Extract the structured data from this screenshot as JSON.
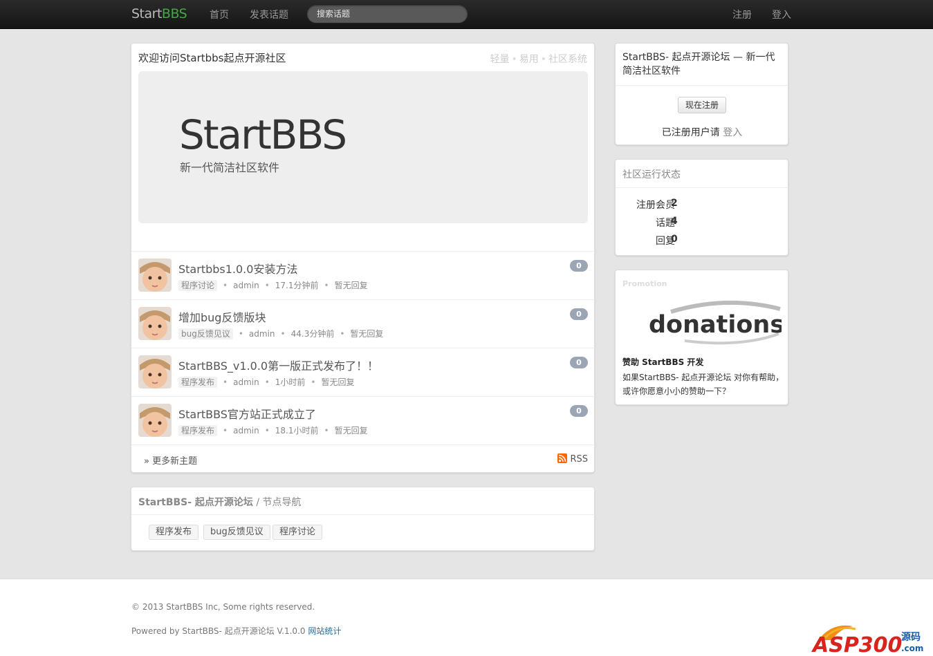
{
  "navbar": {
    "brand_part1": "Start",
    "brand_part2": "BBS",
    "links": [
      "首页",
      "发表话题"
    ],
    "search_placeholder": "搜索话题",
    "register": "注册",
    "login": "登入"
  },
  "welcome": {
    "title": "欢迎访问Startbbs起点开源社区",
    "tagline": [
      "轻量",
      "易用",
      "社区系统"
    ],
    "hero_brand": "StartBBS",
    "hero_sub": "新一代简洁社区软件"
  },
  "topics": [
    {
      "title": "Startbbs1.0.0安装方法",
      "node": "程序讨论",
      "author": "admin",
      "time": "17.1分钟前",
      "reply": "暂无回复",
      "count": "0"
    },
    {
      "title": "增加bug反馈版块",
      "node": "bug反馈见议",
      "author": "admin",
      "time": "44.3分钟前",
      "reply": "暂无回复",
      "count": "0"
    },
    {
      "title": "StartBBS_v1.0.0第一版正式发布了！！",
      "node": "程序发布",
      "author": "admin",
      "time": "1小时前",
      "reply": "暂无回复",
      "count": "0"
    },
    {
      "title": "StartBBS官方站正式成立了",
      "node": "程序发布",
      "author": "admin",
      "time": "18.1小时前",
      "reply": "暂无回复",
      "count": "0"
    }
  ],
  "more": {
    "label": "» 更多新主题",
    "rss": "RSS"
  },
  "nodes_box": {
    "site": "StartBBS- 起点开源论坛",
    "sep": " / 节点导航",
    "nodes": [
      "程序发布",
      "bug反馈见议",
      "程序讨论"
    ]
  },
  "sidebar": {
    "intro": "StartBBS- 起点开源论坛 — 新一代简洁社区软件",
    "register_button": "现在注册",
    "login_hint": "已注册用户请",
    "login_link": "登入",
    "stats_title": "社区运行状态",
    "stats": [
      {
        "label": "注册会员",
        "value": "2"
      },
      {
        "label": "话题",
        "value": "4"
      },
      {
        "label": "回复",
        "value": "0"
      }
    ],
    "promo_label": "Promotion",
    "donate_logo": "donations",
    "donate_title": "赞助 StartBBS 开发",
    "donate_text": "如果StartBBS- 起点开源论坛 对你有帮助，或许你愿意小小的赞助一下？"
  },
  "footer": {
    "copyright": "© 2013 StartBBS Inc, Some rights reserved.",
    "powered": "Powered by StartBBS- 起点开源论坛 V.1.0.0",
    "stats_link": "网站统计",
    "watermark": "ASP300",
    "watermark2": "源码",
    "watermark3": ".com"
  }
}
